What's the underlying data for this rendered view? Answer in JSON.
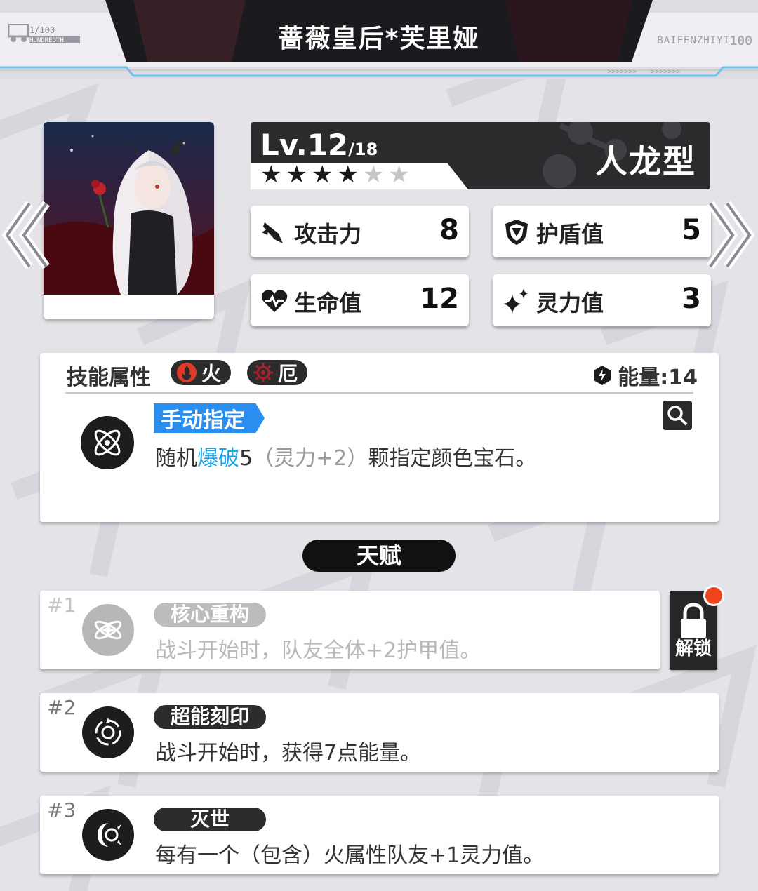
{
  "header": {
    "title": "蔷薇皇后*芙里娅",
    "left_badge": "1/100",
    "left_sub": "HUNDREDTH",
    "right_badge": "BAIFENZHIYI",
    "right_num": "100",
    "arrows_1": ">>>>>>>",
    "arrows_2": ">>>>>>>"
  },
  "character": {
    "level": "Lv.12",
    "level_max": "/18",
    "type": "人龙型",
    "stars_filled": 4,
    "stars_total": 6
  },
  "stats": {
    "attack": {
      "label": "攻击力",
      "value": "8",
      "icon": "sword-icon"
    },
    "shield": {
      "label": "护盾值",
      "value": "5",
      "icon": "shield-icon"
    },
    "hp": {
      "label": "生命值",
      "value": "12",
      "icon": "heart-icon"
    },
    "spirit": {
      "label": "灵力值",
      "value": "3",
      "icon": "sparkle-icon"
    }
  },
  "skill": {
    "title": "技能属性",
    "attr1": "火",
    "attr2": "厄",
    "energy": "能量:14",
    "tag": "手动指定",
    "desc_1": "随机",
    "desc_hl": "爆破",
    "desc_2": "5",
    "desc_dim": "（灵力+2）",
    "desc_3": "颗指定颜色宝石。"
  },
  "talent": {
    "header": "天赋",
    "unlock_label": "解锁",
    "items": [
      {
        "num": "#1",
        "name": "核心重构",
        "desc": "战斗开始时，队友全体+2护甲值。"
      },
      {
        "num": "#2",
        "name": "超能刻印",
        "desc": "战斗开始时，获得7点能量。"
      },
      {
        "num": "#3",
        "name": "灭世",
        "desc": "每有一个（包含）火属性队友+1灵力值。"
      }
    ]
  },
  "colors": {
    "accent_blue": "#2a8df0",
    "highlight": "#19a3e8",
    "notification": "#f0441e",
    "dark": "#1d1d1d"
  }
}
